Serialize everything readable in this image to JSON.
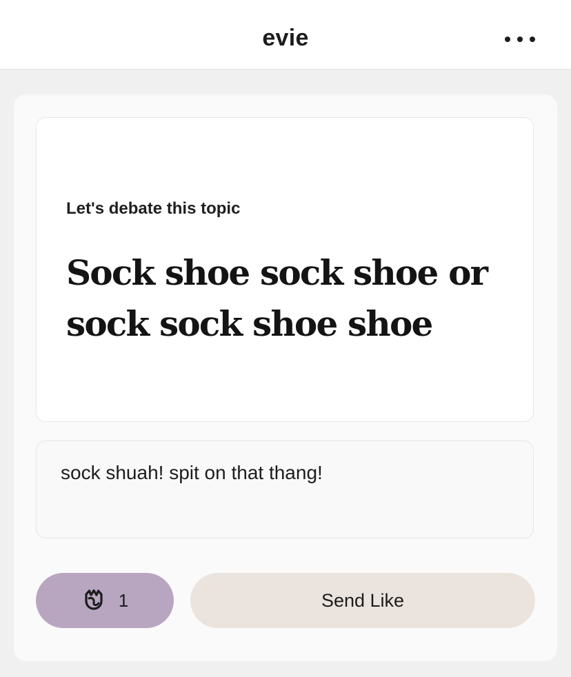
{
  "header": {
    "title": "evie",
    "more_icon": "more-horizontal-icon"
  },
  "prompt": {
    "label": "Let's debate this topic",
    "text": "Sock shoe sock shoe or sock sock shoe shoe"
  },
  "answer": {
    "text": "sock shuah! spit on that thang!"
  },
  "actions": {
    "rose_icon": "rose-icon",
    "rose_count": "1",
    "send_label": "Send Like"
  },
  "colors": {
    "background": "#f0f0f0",
    "rose_button": "#b8a6c1",
    "send_button": "#ebe3dd"
  }
}
